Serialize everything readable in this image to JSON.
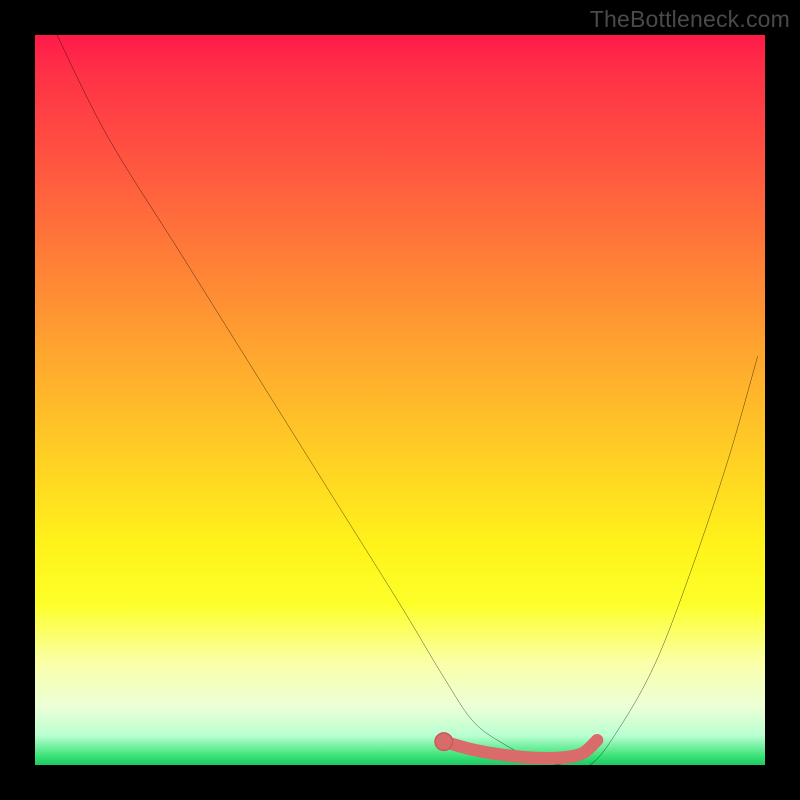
{
  "watermark": {
    "text": "TheBottleneck.com"
  },
  "colors": {
    "frame": "#000000",
    "curve": "#000000",
    "marker_fill": "#d96b6b",
    "marker_stroke": "#c85a5a",
    "gradient_top": "#ff1a4a",
    "gradient_bottom": "#1fc766"
  },
  "chart_data": {
    "type": "line",
    "title": "",
    "xlabel": "",
    "ylabel": "",
    "xlim": [
      0,
      100
    ],
    "ylim": [
      0,
      100
    ],
    "grid": false,
    "legend": false,
    "series": [
      {
        "name": "bottleneck-curve",
        "x": [
          3,
          10,
          20,
          30,
          40,
          50,
          56,
          60,
          64,
          68,
          72,
          76,
          80,
          85,
          90,
          95,
          99
        ],
        "values": [
          100,
          86,
          70,
          54,
          38,
          22,
          12,
          6,
          3,
          1,
          0,
          0,
          5,
          14,
          27,
          42,
          56
        ]
      }
    ],
    "markers": {
      "name": "optimal-range",
      "x": [
        56,
        60,
        64,
        68,
        72,
        75,
        77
      ],
      "values": [
        3.2,
        2.1,
        1.4,
        1.0,
        1.0,
        1.6,
        3.4
      ],
      "style": "thick-salmon"
    }
  }
}
